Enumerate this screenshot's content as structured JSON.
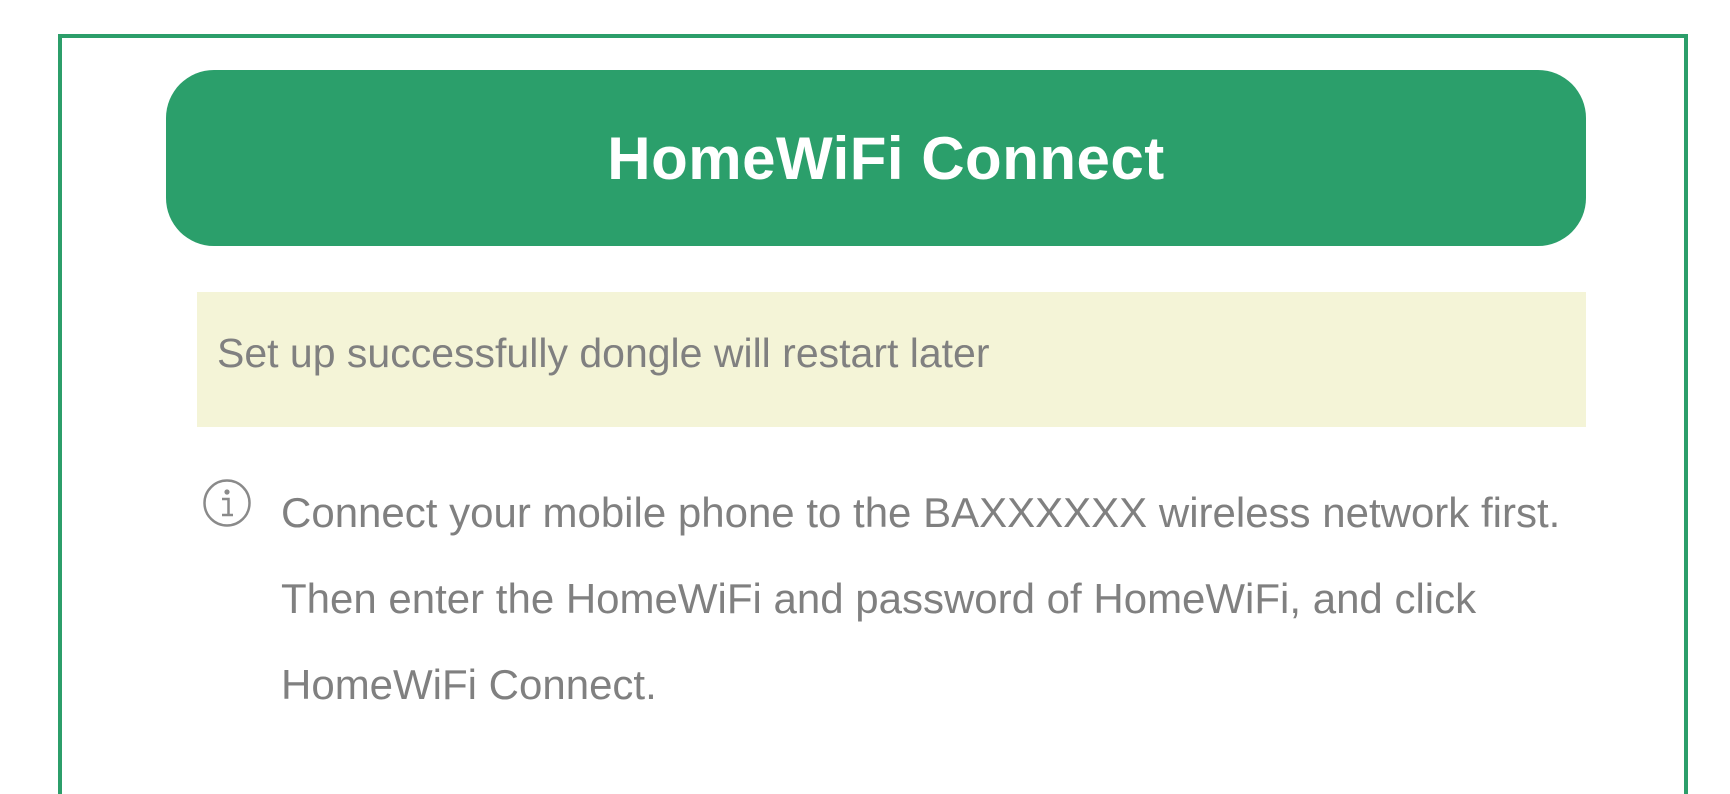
{
  "header": {
    "connect_button_label": "HomeWiFi Connect"
  },
  "status": {
    "message": "Set up successfully dongle will restart later"
  },
  "info": {
    "icon": "info-icon",
    "text": "Connect your mobile phone to the BAXXXXXX wireless network first. Then enter the HomeWiFi and password of HomeWiFi, and click HomeWiFi Connect."
  },
  "colors": {
    "accent": "#2b9f6b",
    "status_background": "#f4f4d7",
    "text_gray": "#808080"
  }
}
